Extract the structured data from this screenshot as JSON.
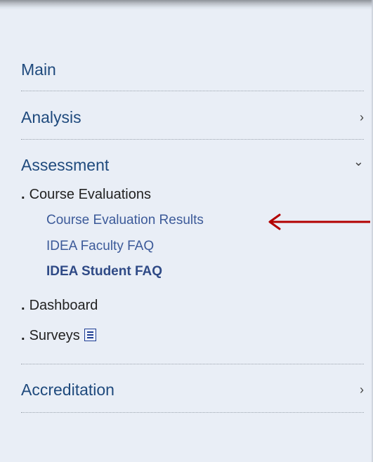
{
  "menu": {
    "main": {
      "label": "Main"
    },
    "analysis": {
      "label": "Analysis",
      "chevron": "›"
    },
    "assessment": {
      "label": "Assessment",
      "chevron": "⌄",
      "course_evaluations": {
        "label": "Course Evaluations",
        "links": [
          {
            "label": "Course Evaluation Results"
          },
          {
            "label": "IDEA Faculty FAQ"
          },
          {
            "label": "IDEA Student FAQ"
          }
        ]
      },
      "dashboard": {
        "label": "Dashboard"
      },
      "surveys": {
        "label": "Surveys",
        "icon": "document-icon"
      }
    },
    "accreditation": {
      "label": "Accreditation",
      "chevron": "›"
    }
  },
  "bullet": ".",
  "colors": {
    "panel_bg": "#e9eef6",
    "menu_text": "#1f4a7d",
    "link": "#3c5a99",
    "annotation_arrow": "#b30000"
  }
}
